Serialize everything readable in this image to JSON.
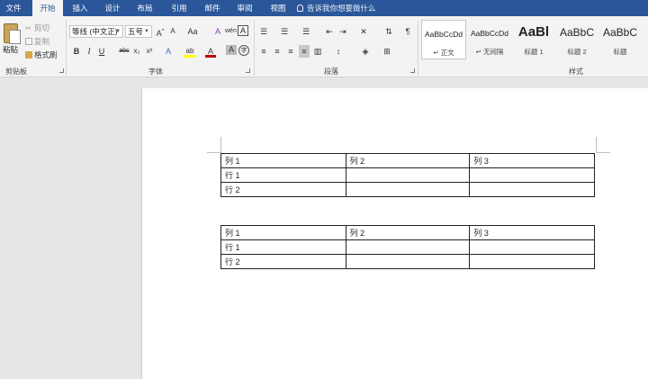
{
  "tabs": [
    "文件",
    "开始",
    "插入",
    "设计",
    "布局",
    "引用",
    "邮件",
    "审阅",
    "视图"
  ],
  "active_tab": "开始",
  "tell_me": "告诉我你想要做什么",
  "clipboard": {
    "paste": "粘贴",
    "cut": "剪切",
    "copy": "复制",
    "format_painter": "格式刷",
    "group": "剪贴板"
  },
  "font": {
    "name": "等线 (中文正)",
    "size": "五号",
    "grow": "A",
    "shrink": "A",
    "case": "Aa",
    "clear": "A",
    "phonetic": "wén",
    "border": "A",
    "bold": "B",
    "italic": "I",
    "underline": "U",
    "strike": "abc",
    "sub": "x₂",
    "sup": "x²",
    "effects": "A",
    "highlight": "ab",
    "color": "A",
    "shade": "A",
    "enclose": "字",
    "group": "字体"
  },
  "paragraph": {
    "group": "段落"
  },
  "styles": {
    "group": "样式",
    "items": [
      {
        "sample": "AaBbCcDd",
        "name": "正文"
      },
      {
        "sample": "AaBbCcDd",
        "name": "无间隔"
      },
      {
        "sample": "AaBl",
        "name": "标题 1"
      },
      {
        "sample": "AaBbC",
        "name": "标题 2"
      },
      {
        "sample": "AaBbC",
        "name": "标题"
      }
    ]
  },
  "tables": [
    {
      "rows": [
        [
          "列 1",
          "列 2",
          "列 3"
        ],
        [
          "行 1",
          "",
          ""
        ],
        [
          "行 2",
          "",
          ""
        ]
      ]
    },
    {
      "rows": [
        [
          "列 1",
          "列 2",
          "列 3"
        ],
        [
          "行 1",
          "",
          ""
        ],
        [
          "行 2",
          "",
          ""
        ]
      ]
    }
  ]
}
